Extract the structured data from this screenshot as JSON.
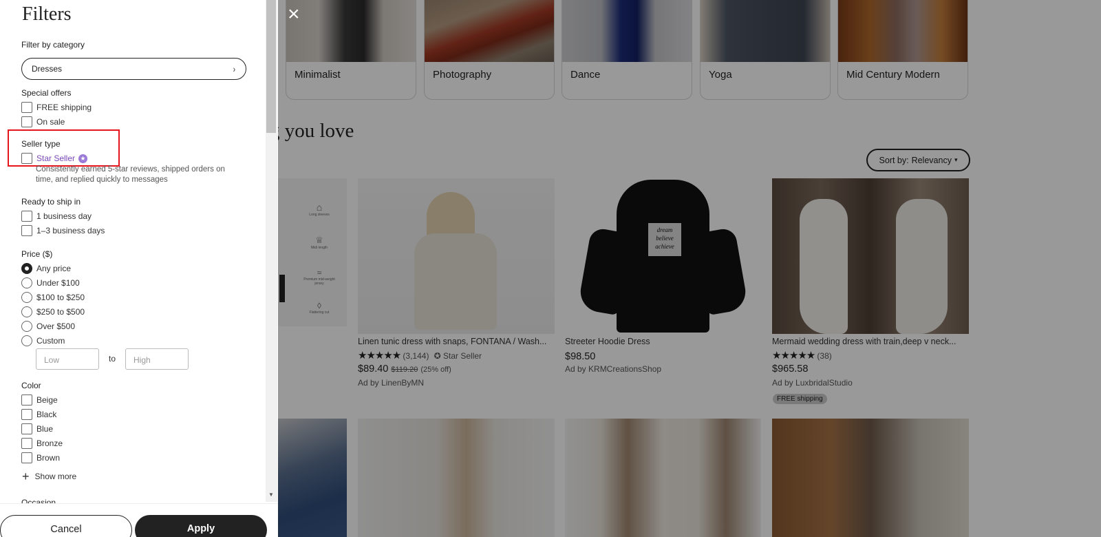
{
  "background": {
    "categories": [
      {
        "label": "Minimalist"
      },
      {
        "label": "Photography"
      },
      {
        "label": "Dance"
      },
      {
        "label": "Yoga"
      },
      {
        "label": "Mid Century Modern"
      }
    ],
    "section_heading": "g you love",
    "sort": {
      "prefix": "Sort by:",
      "value": "Relevancy",
      "arrow": "▾"
    },
    "products": [
      {
        "title": "Linen tunic dress with snaps, FONTANA / Wash...",
        "stars": "★★★★★",
        "rating_count": "(3,144)",
        "badge": "Star Seller",
        "price": "$89.40",
        "old_price": "$119.20",
        "discount": "(25% off)",
        "ad": "Ad by LinenByMN"
      },
      {
        "title": "Streeter Hoodie Dress",
        "price": "$98.50",
        "ad": "Ad by KRMCreationsShop",
        "print_lines": [
          "dream",
          "believe",
          "achieve"
        ]
      },
      {
        "title": "Mermaid wedding dress with train,deep v neck...",
        "stars": "★★★★★",
        "rating_count": "(38)",
        "price": "$965.58",
        "ad": "Ad by LuxbridalStudio",
        "badge": "FREE shipping"
      }
    ],
    "feature_icons": [
      "Long sleeves",
      "Midi length",
      "Premium mid-weight jersey",
      "Flattering cut"
    ]
  },
  "close_icon": "×",
  "filters": {
    "title": "Filters",
    "category": {
      "label": "Filter by category",
      "value": "Dresses",
      "chevron": "›"
    },
    "special_offers": {
      "label": "Special offers",
      "options": [
        "FREE shipping",
        "On sale"
      ]
    },
    "seller_type": {
      "label": "Seller type",
      "option": "Star Seller",
      "description": "Consistently earned 5-star reviews, shipped orders on time, and replied quickly to messages"
    },
    "ready_to_ship": {
      "label": "Ready to ship in",
      "options": [
        "1 business day",
        "1–3 business days"
      ]
    },
    "price": {
      "label": "Price ($)",
      "options": [
        "Any price",
        "Under $100",
        "$100 to $250",
        "$250 to $500",
        "Over $500",
        "Custom"
      ],
      "selected": "Any price",
      "low_placeholder": "Low",
      "to": "to",
      "high_placeholder": "High"
    },
    "color": {
      "label": "Color",
      "options": [
        "Beige",
        "Black",
        "Blue",
        "Bronze",
        "Brown"
      ]
    },
    "show_more": "Show more",
    "occasion_label": "Occasion",
    "cancel": "Cancel",
    "apply": "Apply"
  },
  "colors": {
    "highlight": "#e8141c",
    "star_seller": "#7a46b8",
    "apply_bg": "#222222"
  }
}
